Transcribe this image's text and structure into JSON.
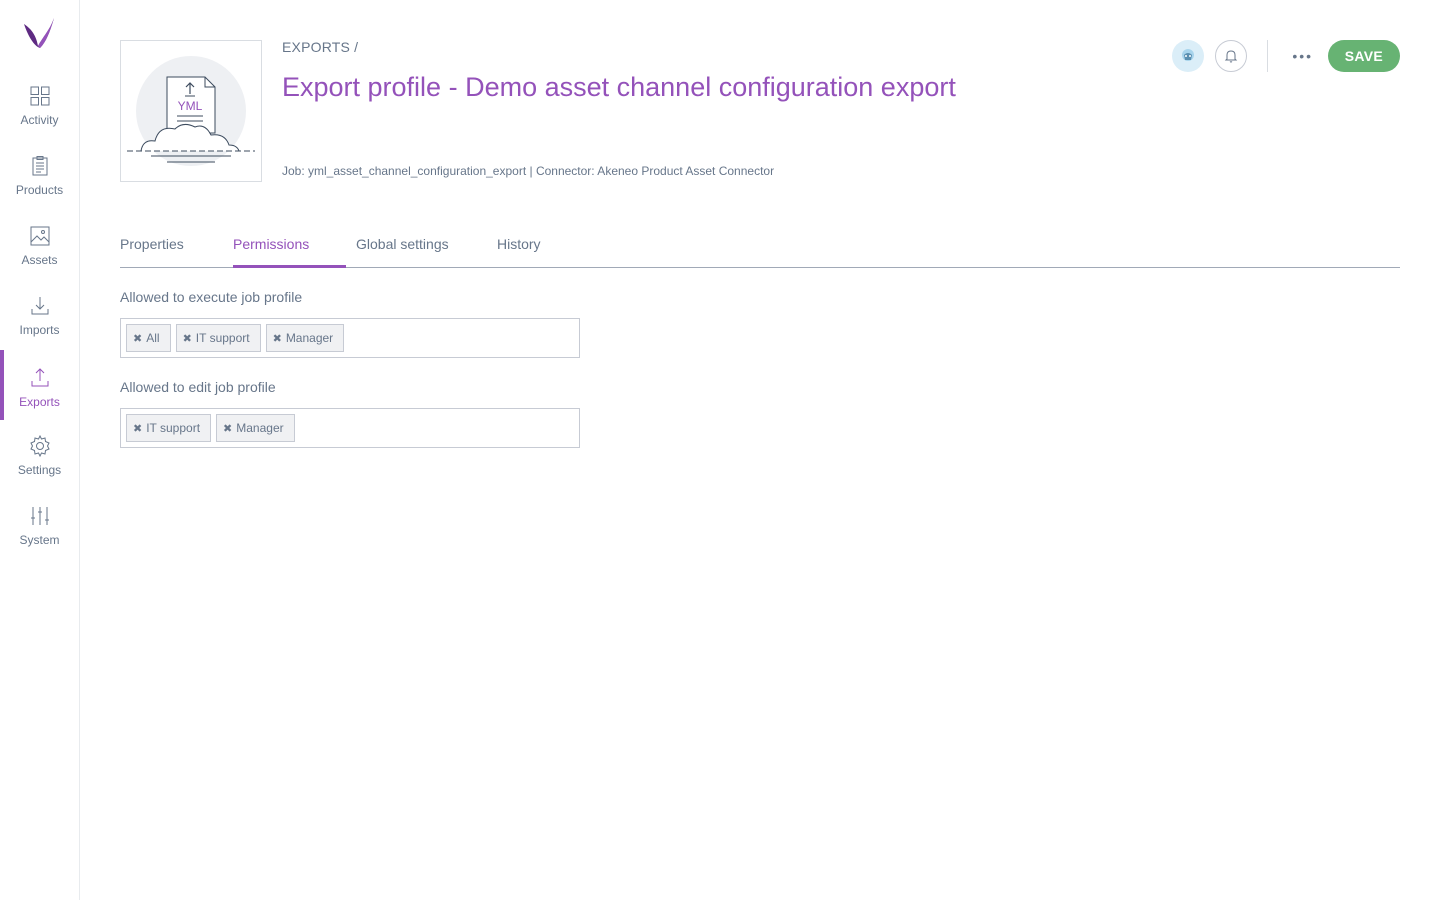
{
  "sidebar": {
    "items": [
      {
        "label": "Activity",
        "icon": "activity-icon"
      },
      {
        "label": "Products",
        "icon": "products-icon"
      },
      {
        "label": "Assets",
        "icon": "assets-icon"
      },
      {
        "label": "Imports",
        "icon": "imports-icon"
      },
      {
        "label": "Exports",
        "icon": "exports-icon",
        "active": true
      },
      {
        "label": "Settings",
        "icon": "settings-icon"
      },
      {
        "label": "System",
        "icon": "system-icon"
      }
    ]
  },
  "header": {
    "breadcrumb": "EXPORTS /",
    "title": "Export profile - Demo asset channel configuration export",
    "meta": "Job: yml_asset_channel_configuration_export | Connector: Akeneo Product Asset Connector",
    "thumbnail_label": "YML",
    "save_label": "SAVE",
    "more_label": "•••"
  },
  "tabs": [
    {
      "label": "Properties"
    },
    {
      "label": "Permissions",
      "active": true
    },
    {
      "label": "Global settings"
    },
    {
      "label": "History"
    }
  ],
  "permissions": {
    "execute": {
      "label": "Allowed to execute job profile",
      "tags": [
        "All",
        "IT support",
        "Manager"
      ]
    },
    "edit": {
      "label": "Allowed to edit job profile",
      "tags": [
        "IT support",
        "Manager"
      ]
    }
  },
  "colors": {
    "accent": "#9452ba",
    "save": "#67b373",
    "text": "#67768a"
  }
}
